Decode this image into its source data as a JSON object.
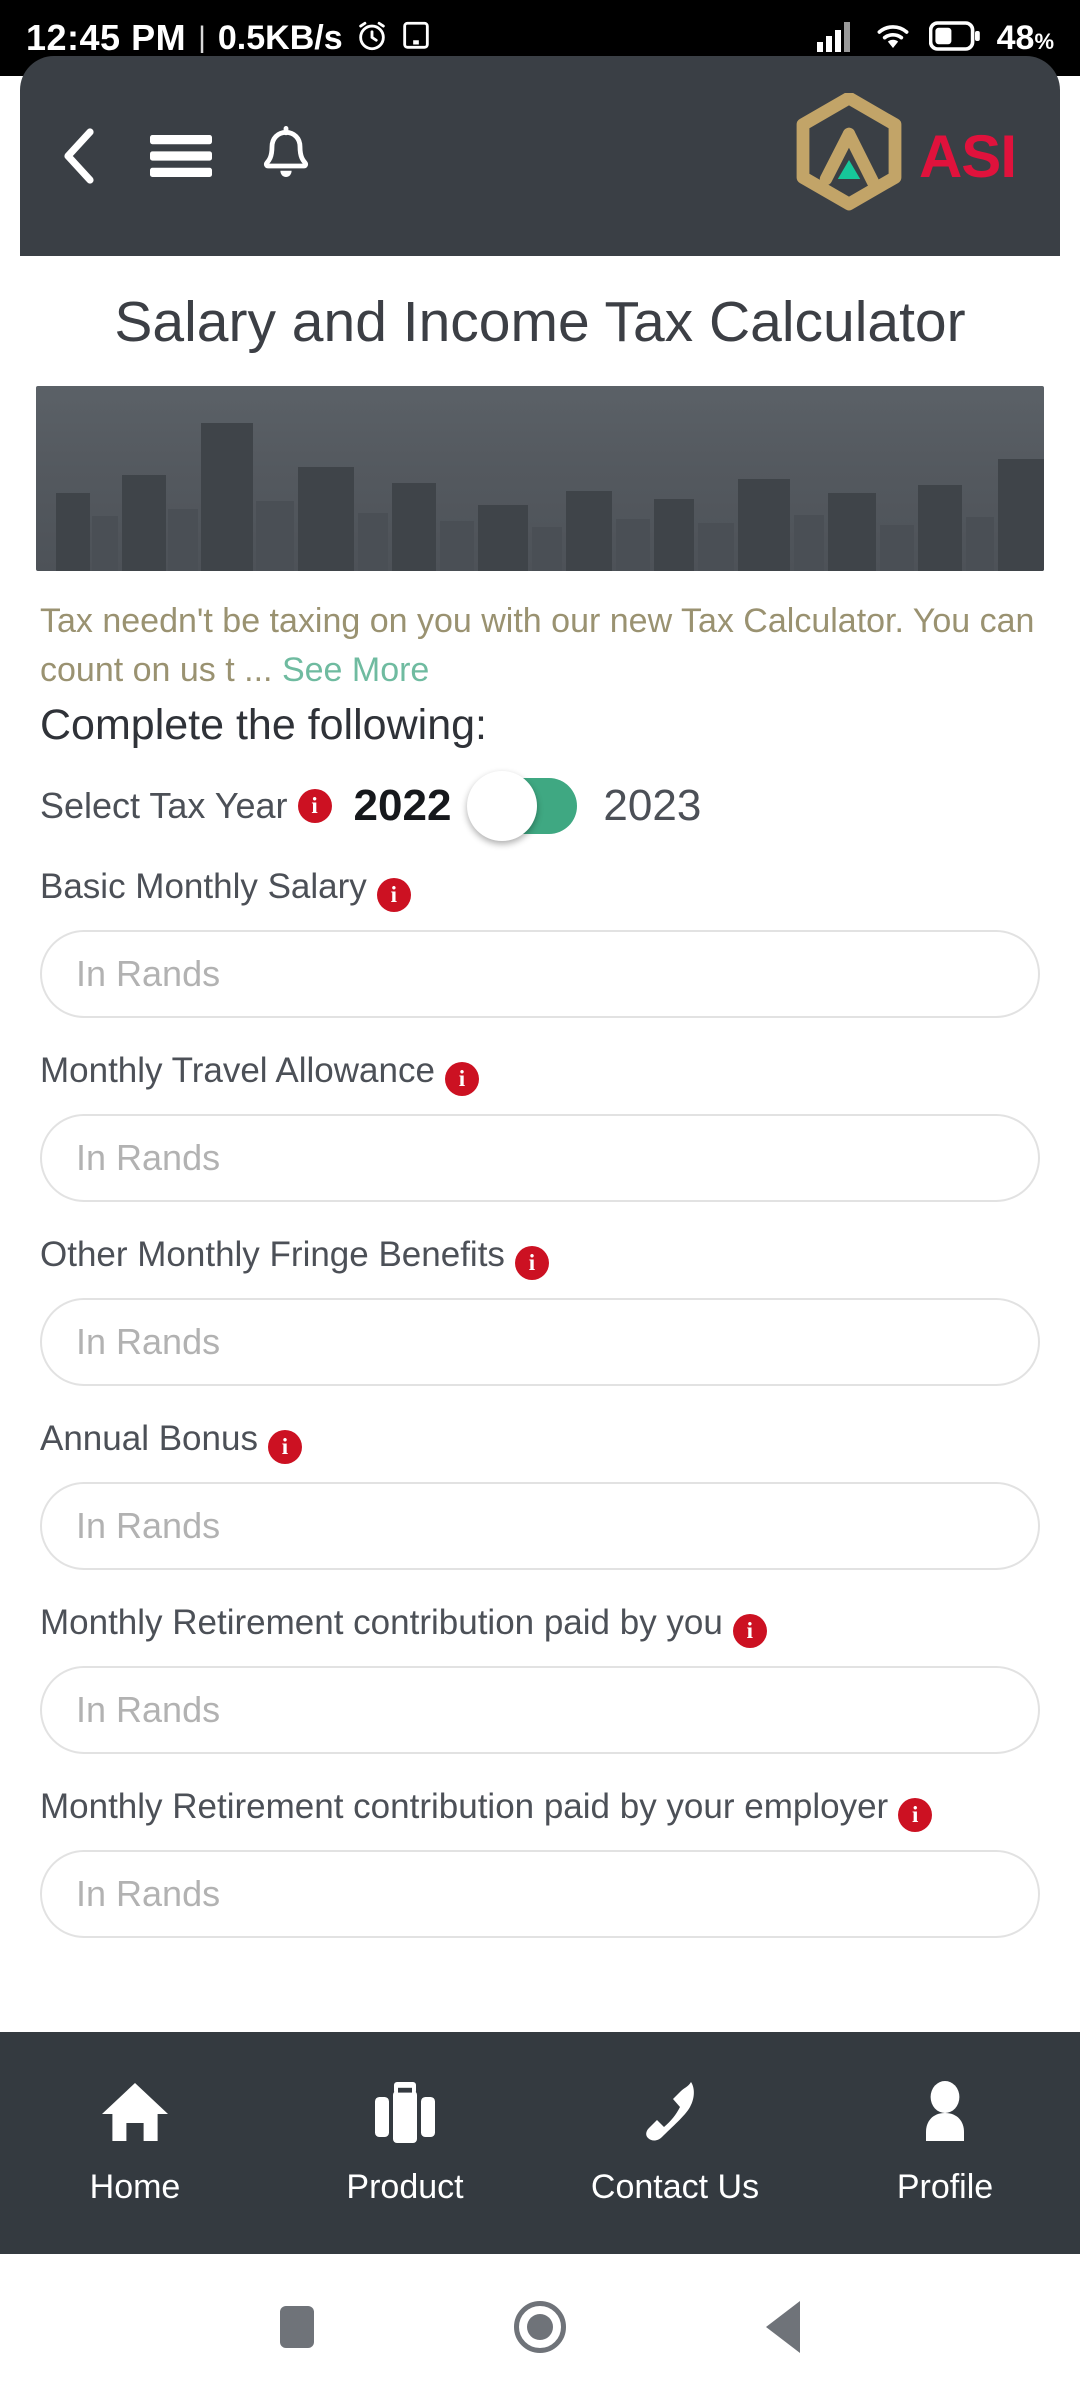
{
  "statusbar": {
    "time": "12:45 PM",
    "separator": "|",
    "network_speed": "0.5KB/s",
    "alarm_icon": "alarm-icon",
    "cast_icon": "cast-icon",
    "signal_icon": "cellular-signal-icon",
    "wifi_icon": "wifi-icon",
    "battery_icon": "battery-icon",
    "battery_percent": "48",
    "battery_unit": "%"
  },
  "appbar": {
    "back_icon": "back-chevron-icon",
    "menu_icon": "hamburger-menu-icon",
    "bell_icon": "notification-bell-icon",
    "logo_icon": "asi-hexagon-logo-icon",
    "brand": "ASI",
    "brand_color": "#e0123c",
    "logo_gold": "#c2a468",
    "logo_teal": "#16c79a",
    "bar_color": "#3a3f45"
  },
  "main": {
    "title": "Salary and Income Tax Calculator",
    "banner_alt": "city-skyline-banner",
    "description": "Tax needn't be taxing on you with our new Tax Calculator. You can count on us t ...",
    "see_more": "See More",
    "see_more_color": "#6fbba0",
    "description_color": "#9a9271",
    "section_heading": "Complete the following:",
    "tax_year": {
      "label": "Select Tax Year",
      "info_icon": "info-icon",
      "option_left": "2022",
      "option_right": "2023",
      "selected": "2022",
      "toggle_color": "#3fa882"
    },
    "fields": [
      {
        "label": "Basic Monthly Salary",
        "info_icon": "info-icon",
        "placeholder": "In Rands",
        "value": ""
      },
      {
        "label": "Monthly Travel Allowance",
        "info_icon": "info-icon",
        "placeholder": "In Rands",
        "value": ""
      },
      {
        "label": "Other Monthly Fringe Benefits",
        "info_icon": "info-icon",
        "placeholder": "In Rands",
        "value": ""
      },
      {
        "label": "Annual Bonus",
        "info_icon": "info-icon",
        "placeholder": "In Rands",
        "value": ""
      },
      {
        "label": "Monthly Retirement contribution paid by you",
        "info_icon": "info-icon",
        "placeholder": "In Rands",
        "value": ""
      },
      {
        "label": "Monthly Retirement contribution paid by your employer",
        "info_icon": "info-icon",
        "placeholder": "In Rands",
        "value": ""
      }
    ]
  },
  "bottomnav": {
    "background": "#343a40",
    "items": [
      {
        "label": "Home",
        "icon": "home-icon"
      },
      {
        "label": "Product",
        "icon": "briefcase-icon"
      },
      {
        "label": "Contact Us",
        "icon": "phone-icon"
      },
      {
        "label": "Profile",
        "icon": "person-icon"
      }
    ]
  },
  "sysnav": {
    "recents_icon": "recents-square-icon",
    "home_icon": "home-circle-icon",
    "back_icon": "back-triangle-icon"
  }
}
